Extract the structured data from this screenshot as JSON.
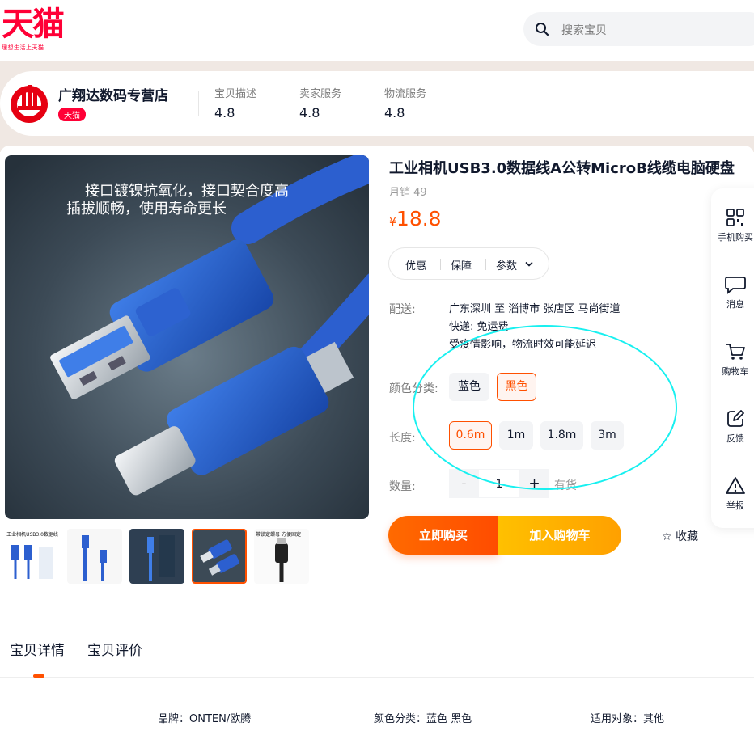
{
  "header": {
    "logo_text": "天猫",
    "logo_slogan": "理想生活上天猫",
    "search_placeholder": "搜索宝贝"
  },
  "shop": {
    "name": "广翔达数码专营店",
    "badge": "天猫",
    "scores": [
      {
        "label": "宝贝描述",
        "value": "4.8"
      },
      {
        "label": "卖家服务",
        "value": "4.8"
      },
      {
        "label": "物流服务",
        "value": "4.8"
      }
    ]
  },
  "gallery": {
    "main_caption_line1": "接口镀镍抗氧化，接口契合度高",
    "main_caption_line2": "插拔顺畅，使用寿命更长",
    "thumb1_caption": "工业相机USB3.0数据线",
    "thumb5_caption": "带锁定螺母 方便固定"
  },
  "product": {
    "title": "工业相机USB3.0数据线A公转MicroB线缆电脑硬盘",
    "monthly_sales": "月销 49",
    "currency": "¥",
    "price": "18.8",
    "tabs": [
      "优惠",
      "保障",
      "参数"
    ]
  },
  "delivery": {
    "label": "配送:",
    "route": "广东深圳 至 淄博市 张店区 马尚街道",
    "express": "快递: 免运费",
    "notice": "受疫情影响，物流时效可能延迟"
  },
  "color": {
    "label": "颜色分类:",
    "options": [
      "蓝色",
      "黑色"
    ],
    "selected": "黑色"
  },
  "length": {
    "label": "长度:",
    "options": [
      "0.6m",
      "1m",
      "1.8m",
      "3m"
    ],
    "selected": "0.6m"
  },
  "quantity": {
    "label": "数量:",
    "minus": "-",
    "value": "1",
    "plus": "+",
    "stock": "有货"
  },
  "actions": {
    "buy_now": "立即购买",
    "add_to_cart": "加入购物车",
    "favorite": "收藏"
  },
  "sidebar": [
    {
      "label": "手机购买",
      "icon": "qrcode-icon"
    },
    {
      "label": "消息",
      "icon": "chat-icon"
    },
    {
      "label": "购物车",
      "icon": "cart-icon"
    },
    {
      "label": "反馈",
      "icon": "edit-icon"
    },
    {
      "label": "举报",
      "icon": "warning-icon"
    }
  ],
  "detail_tabs": [
    "宝贝详情",
    "宝贝评价"
  ],
  "attributes": [
    "品牌：ONTEN/欧腾",
    "颜色分类：蓝色 黑色",
    "适用对象：其他"
  ],
  "colors": {
    "accent": "#ff5000",
    "tmall_red": "#ff0036",
    "buy_start": "#ff6a00",
    "cart_start": "#ffc000",
    "annotation": "#18f0f0"
  }
}
